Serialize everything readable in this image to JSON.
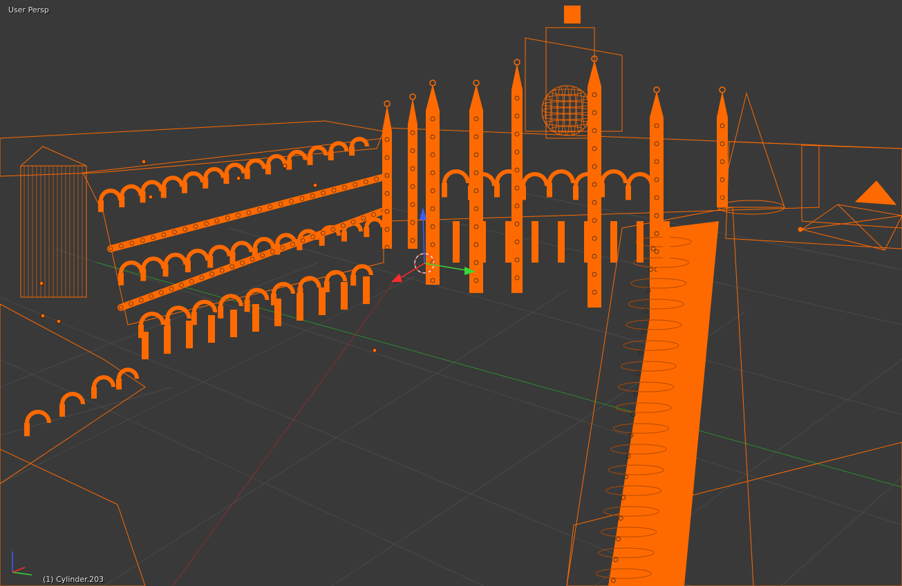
{
  "viewport": {
    "view_name": "User Persp",
    "object_info": "(1) Cylinder.203"
  },
  "colors": {
    "background": "#393939",
    "grid_line": "#4a4a4a",
    "grid_x_axis": "#2e8b2e",
    "grid_y_axis": "#8a2e2e",
    "selection_wire": "#ff6a00",
    "origin_dot": "#ff6a00",
    "gizmo_x": "#ff2a2a",
    "gizmo_y": "#39d839",
    "gizmo_z": "#3a5dff",
    "cursor_ring": "#ffffff"
  },
  "icons": {
    "transform_manipulator": "move-gizmo-icon",
    "cursor_3d": "3d-cursor-icon",
    "axis_orientation": "axis-gizmo-icon"
  }
}
